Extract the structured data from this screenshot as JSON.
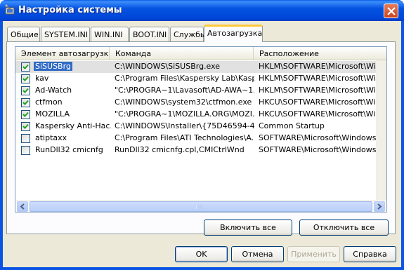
{
  "window": {
    "title": "Настройка системы",
    "accent_color": "#0a54e4",
    "icon": "system-config-icon"
  },
  "tabs": [
    {
      "label": "Общие",
      "active": false
    },
    {
      "label": "SYSTEM.INI",
      "active": false
    },
    {
      "label": "WIN.INI",
      "active": false
    },
    {
      "label": "BOOT.INI",
      "active": false
    },
    {
      "label": "Службы",
      "active": false
    },
    {
      "label": "Автозагрузка",
      "active": true
    }
  ],
  "startup_list": {
    "columns": [
      "Элемент автозагрузки",
      "Команда",
      "Расположение"
    ],
    "rows": [
      {
        "name": "SiSUSBrg",
        "checked": true,
        "selected": true,
        "command": "C:\\WINDOWS\\SiSUSBrg.exe",
        "location": "HKLM\\SOFTWARE\\Microsoft\\Windows\\"
      },
      {
        "name": "kav",
        "checked": true,
        "selected": false,
        "command": "C:\\Program Files\\Kaspersky Lab\\Kasp...",
        "location": "HKLM\\SOFTWARE\\Microsoft\\Windows\\"
      },
      {
        "name": "Ad-Watch",
        "checked": true,
        "selected": false,
        "command": "\"C:\\PROGRA~1\\Lavasoft\\AD-AWA~1...",
        "location": "HKLM\\SOFTWARE\\Microsoft\\Windows\\"
      },
      {
        "name": "ctfmon",
        "checked": true,
        "selected": false,
        "command": "C:\\WINDOWS\\system32\\ctfmon.exe",
        "location": "HKCU\\SOFTWARE\\Microsoft\\Windows\\"
      },
      {
        "name": "MOZILLA",
        "checked": true,
        "selected": false,
        "command": "\"C:\\PROGRA~1\\MOZILLA.ORG\\MOZI...",
        "location": "HKCU\\SOFTWARE\\Microsoft\\Windows\\"
      },
      {
        "name": "Kaspersky Anti-Hac...",
        "checked": true,
        "selected": false,
        "command": "C:\\WINDOWS\\Installer\\{75D46594-4...",
        "location": "Common Startup"
      },
      {
        "name": "atiptaxx",
        "checked": false,
        "selected": false,
        "command": "C:\\Program Files\\ATI Technologies\\A...",
        "location": "SOFTWARE\\Microsoft\\Windows\\Curren"
      },
      {
        "name": "RunDll32 cmicnfg",
        "checked": false,
        "selected": false,
        "command": "RunDll32 cmicnfg.cpl,CMICtrlWnd",
        "location": "SOFTWARE\\Microsoft\\Windows\\Curren"
      }
    ]
  },
  "panel_buttons": {
    "enable_all": "Включить все",
    "disable_all": "Отключить все"
  },
  "dialog_buttons": {
    "ok": "OK",
    "cancel": "Отмена",
    "apply": "Применить",
    "help": "Справка"
  }
}
